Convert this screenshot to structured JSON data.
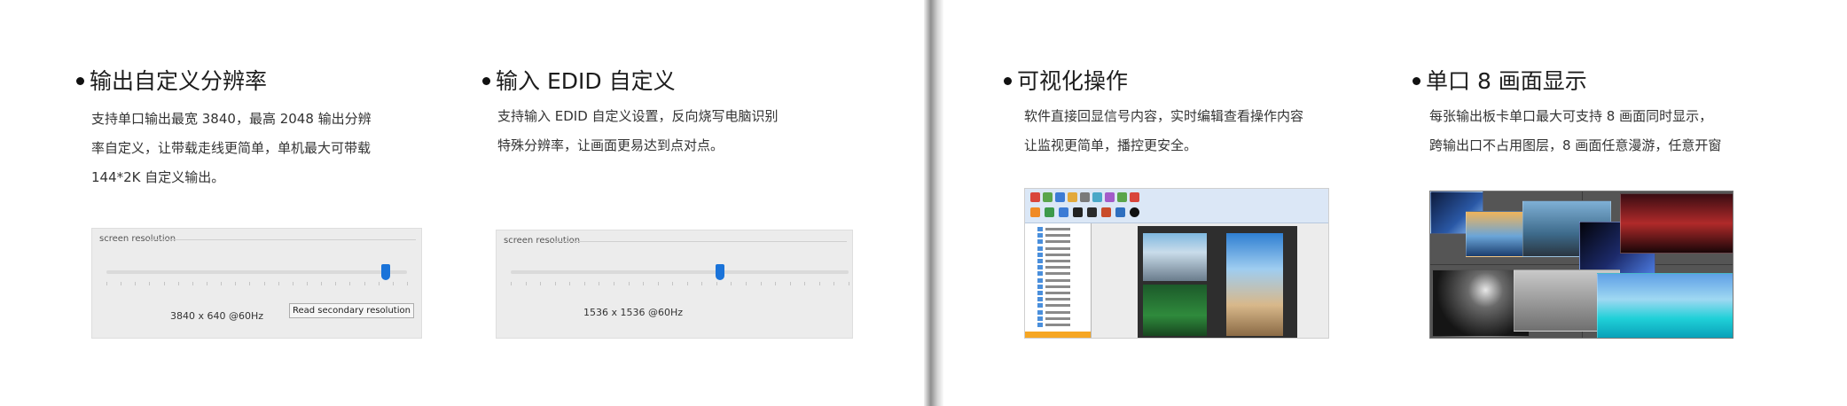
{
  "features": [
    {
      "title": "输出自定义分辨率",
      "desc": [
        "支持单口输出最宽 3840，最高 2048 输出分辨",
        "率自定义，让带载走线更简单，单机最大可带载",
        "144*2K 自定义输出。"
      ]
    },
    {
      "title": "输入 EDID 自定义",
      "desc": [
        "支持输入 EDID 自定义设置，反向烧写电脑识别",
        "特殊分辨率，让画面更易达到点对点。"
      ]
    },
    {
      "title": "可视化操作",
      "desc": [
        "软件直接回显信号内容，实时编辑查看操作内容",
        "让监视更简单，播控更安全。"
      ]
    },
    {
      "title": "单口 8 画面显示",
      "desc": [
        "每张输出板卡单口最大可支持 8 画面同时显示，",
        "跨输出口不占用图层，8 画面任意漫游，任意开窗"
      ]
    }
  ],
  "panel_output": {
    "caption": "screen resolution",
    "value_text": "3840 x 640 @60Hz",
    "button_label": "Read secondary resolution",
    "slider_level": 0.93
  },
  "panel_input": {
    "caption": "screen resolution",
    "value_text": "1536 x 1536 @60Hz",
    "slider_level": 0.62
  },
  "colors": {
    "slider_thumb": "#1a73d9",
    "panel_bg": "#ececec",
    "tree_footer": "#f6a623"
  }
}
